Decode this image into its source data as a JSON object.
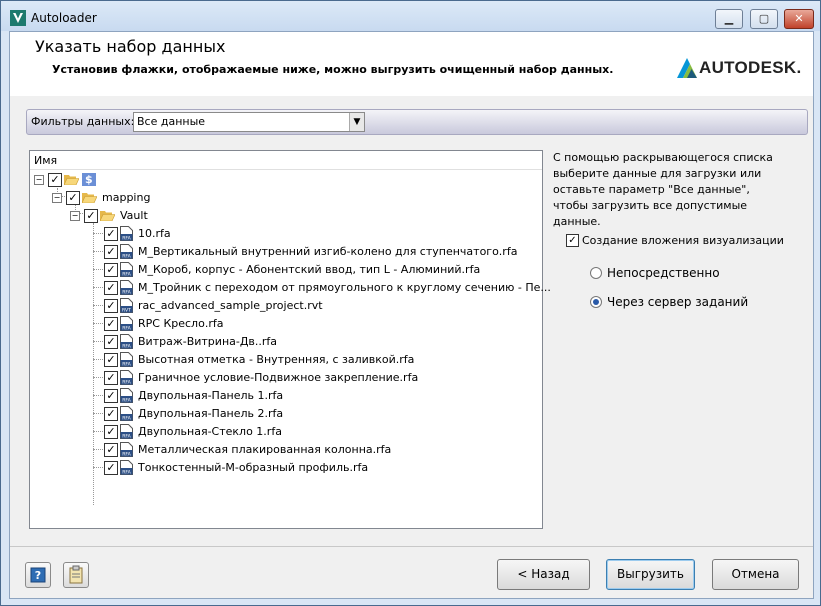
{
  "window": {
    "title": "Autoloader",
    "minimize": "▁",
    "maximize": "▢",
    "close": "✕"
  },
  "header": {
    "title": "Указать набор данных",
    "subtitle": "Установив флажки, отображаемые ниже, можно выгрузить очищенный набор данных.",
    "brand": "AUTODESK."
  },
  "filter": {
    "label": "Фильтры данных:",
    "value": "Все данные"
  },
  "tree": {
    "column_header": "Имя",
    "root": {
      "label": "$",
      "checked": true
    },
    "level1": {
      "label": "mapping",
      "checked": true
    },
    "level2": {
      "label": "Vault",
      "checked": true
    },
    "files": [
      {
        "name": "10.rfa",
        "checked": true,
        "type": "RFA"
      },
      {
        "name": "М_Вертикальный внутренний изгиб-колено для ступенчатого.rfa",
        "checked": true,
        "type": "RFA"
      },
      {
        "name": "М_Короб, корпус - Абонентский ввод, тип L - Алюминий.rfa",
        "checked": true,
        "type": "RFA"
      },
      {
        "name": "М_Тройник с переходом от прямоугольного к круглому сечению - Пе...",
        "checked": true,
        "type": "RFA"
      },
      {
        "name": "rac_advanced_sample_project.rvt",
        "checked": true,
        "type": "RVT"
      },
      {
        "name": "RPC Кресло.rfa",
        "checked": true,
        "type": "RFA"
      },
      {
        "name": "Витраж-Витрина-Дв..rfa",
        "checked": true,
        "type": "RFA"
      },
      {
        "name": "Высотная отметка - Внутренняя, с заливкой.rfa",
        "checked": true,
        "type": "RFA"
      },
      {
        "name": "Граничное условие-Подвижное закрепление.rfa",
        "checked": true,
        "type": "RFA"
      },
      {
        "name": "Двупольная-Панель 1.rfa",
        "checked": true,
        "type": "RFA"
      },
      {
        "name": "Двупольная-Панель 2.rfa",
        "checked": true,
        "type": "RFA"
      },
      {
        "name": "Двупольная-Стекло 1.rfa",
        "checked": true,
        "type": "RFA"
      },
      {
        "name": "Металлическая плакированная колонна.rfa",
        "checked": true,
        "type": "RFA"
      },
      {
        "name": "Тонкостенный-М-образный профиль.rfa",
        "checked": true,
        "type": "RFA"
      }
    ]
  },
  "description": "С помощью раскрывающегося списка выберите данные для загрузки или оставьте параметр \"Все данные\", чтобы загрузить все допустимые данные.",
  "options": {
    "create_attachment": {
      "label": "Создание вложения визуализации",
      "checked": true
    },
    "radio_direct": {
      "label": "Непосредственно",
      "selected": false
    },
    "radio_server": {
      "label": "Через сервер заданий",
      "selected": true
    }
  },
  "footer": {
    "back": "< Назад",
    "upload": "Выгрузить",
    "cancel": "Отмена"
  },
  "colors": {
    "accent": "#2a5aa8",
    "titlebar": "#c8daf0",
    "close": "#c0422a"
  }
}
